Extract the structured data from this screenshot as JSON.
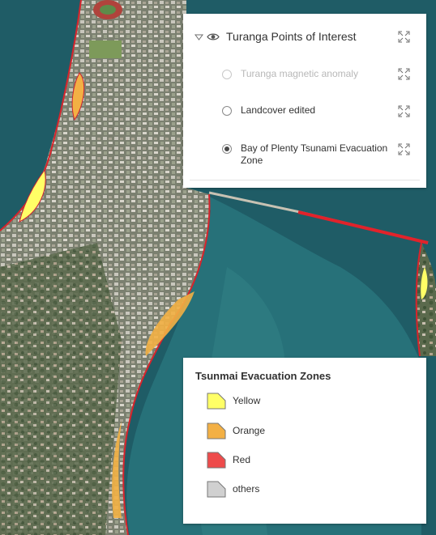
{
  "layer_list": {
    "group": {
      "title": "Turanga Points of Interest",
      "icons": [
        "caret-down-icon",
        "eye-icon",
        "expand-icon"
      ]
    },
    "sublayers": [
      {
        "label": "Turanga magnetic anomaly",
        "state": "disabled"
      },
      {
        "label": "Landcover edited",
        "state": "unchecked"
      },
      {
        "label": "Bay of Plenty Tsunami Evacuation Zone",
        "state": "checked"
      }
    ]
  },
  "legend": {
    "title": "Tsunmai Evacuation Zones",
    "items": [
      {
        "label": "Yellow",
        "color": "#ffff66"
      },
      {
        "label": "Orange",
        "color": "#f3b044"
      },
      {
        "label": "Red",
        "color": "#ee4b4b"
      },
      {
        "label": "others",
        "color": "#d0d0d0"
      }
    ]
  },
  "map": {
    "water_color": "#1d5a63",
    "land_color": "#6b7360",
    "zone_outline_color": "#d8242c"
  }
}
